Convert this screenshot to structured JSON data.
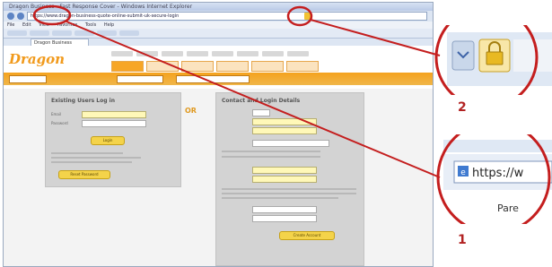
{
  "browser": {
    "window_title": "Dragon Business - Fast Response Cover - Windows Internet Explorer",
    "url": "https://www.dragon-business-quote-online-submit-uk-secure-login",
    "menu": [
      "File",
      "Edit",
      "View",
      "Favorites",
      "Tools",
      "Help"
    ],
    "tab_label": "Dragon Business"
  },
  "site": {
    "logo": "Dragon",
    "existing_panel_title": "Existing Users Log in",
    "email_label": "Email",
    "password_label": "Password",
    "login_button": "Login",
    "forgot_button": "Reset Password",
    "or_label": "OR",
    "new_panel_title": "Contact and Login Details",
    "create_button": "Create Account"
  },
  "callouts": {
    "num_2": "2",
    "num_1": "1",
    "zoom1_text": "https://w",
    "zoom1_sub": "Pare"
  },
  "colors": {
    "callout_red": "#c41e1e",
    "orange": "#f5a21e",
    "lock_gold": "#e8b923"
  }
}
